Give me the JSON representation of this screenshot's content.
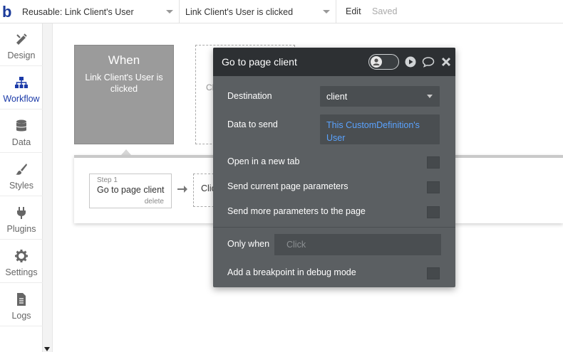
{
  "topbar": {
    "logo_text": "b",
    "page_dropdown": "Reusable: Link Client's User",
    "event_dropdown": "Link Client's User is clicked",
    "edit_label": "Edit",
    "saved_label": "Saved"
  },
  "sidebar": {
    "items": [
      {
        "label": "Design",
        "icon": "design-icon"
      },
      {
        "label": "Workflow",
        "icon": "workflow-icon"
      },
      {
        "label": "Data",
        "icon": "database-icon"
      },
      {
        "label": "Styles",
        "icon": "brush-icon"
      },
      {
        "label": "Plugins",
        "icon": "plug-icon"
      },
      {
        "label": "Settings",
        "icon": "gear-icon"
      },
      {
        "label": "Logs",
        "icon": "document-icon"
      }
    ],
    "active": "Workflow",
    "accent_color": "#1b3aa8"
  },
  "event": {
    "title": "When",
    "description": "Link Client's User is clicked",
    "next_placeholder": "Cl"
  },
  "steps": [
    {
      "number": "Step 1",
      "name": "Go to page client",
      "delete_label": "delete"
    }
  ],
  "add_step_placeholder": "Clic",
  "panel": {
    "title": "Go to page client",
    "destination_label": "Destination",
    "destination_value": "client",
    "data_label": "Data to send",
    "data_value": "This CustomDefinition's User",
    "options": [
      {
        "label": "Open in a new tab",
        "checked": false
      },
      {
        "label": "Send current page parameters",
        "checked": false
      },
      {
        "label": "Send more parameters to the page",
        "checked": false
      }
    ],
    "only_when_label": "Only when",
    "only_when_placeholder": "Click",
    "breakpoint_label": "Add a breakpoint in debug mode",
    "breakpoint_checked": false
  }
}
